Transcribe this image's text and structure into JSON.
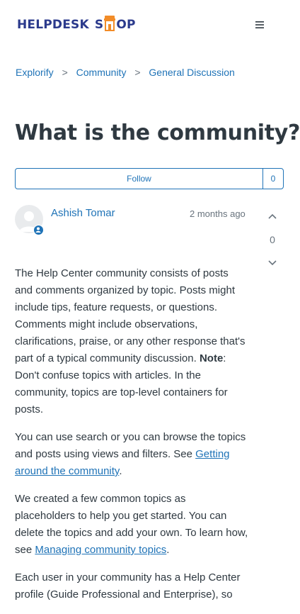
{
  "header": {
    "logo_part1": "HELPDESK",
    "logo_part2": "S",
    "logo_part3": "OP",
    "menu_icon": "hamburger-menu-icon",
    "brand_color": "#2b3a8c",
    "accent_color": "#f28c28"
  },
  "breadcrumbs": {
    "items": [
      "Explorify",
      "Community",
      "General Discussion"
    ],
    "separator": ">"
  },
  "post": {
    "title": "What is the community?",
    "follow_label": "Follow",
    "follow_count": "0",
    "author": "Ashish Tomar",
    "time": "2 months ago",
    "vote_count": "0",
    "paragraph1_part1": "The Help Center community consists of posts and comments organized by topic. Posts might include tips, feature requests, or questions. Comments might include observations, clarifications, praise, or any other response that's part of a typical community discussion. ",
    "paragraph1_note": "Note",
    "paragraph1_part2": ": Don't confuse topics with articles. In the community, topics are top-level containers for posts.",
    "paragraph2_part1": "You can use search or you can browse the topics and posts using views and filters. See ",
    "paragraph2_link": "Getting around the community",
    "paragraph2_part2": ".",
    "paragraph3_part1": "We created a few common topics as placeholders to help you get started. You can delete the topics and add your own. To learn how, see ",
    "paragraph3_link": "Managing community topics",
    "paragraph3_part2": ".",
    "paragraph4": "Each user in your community has a Help Center profile (Guide Professional and Enterprise), so"
  },
  "colors": {
    "link": "#1f73b7",
    "text": "#2f3941",
    "muted": "#68737d"
  }
}
